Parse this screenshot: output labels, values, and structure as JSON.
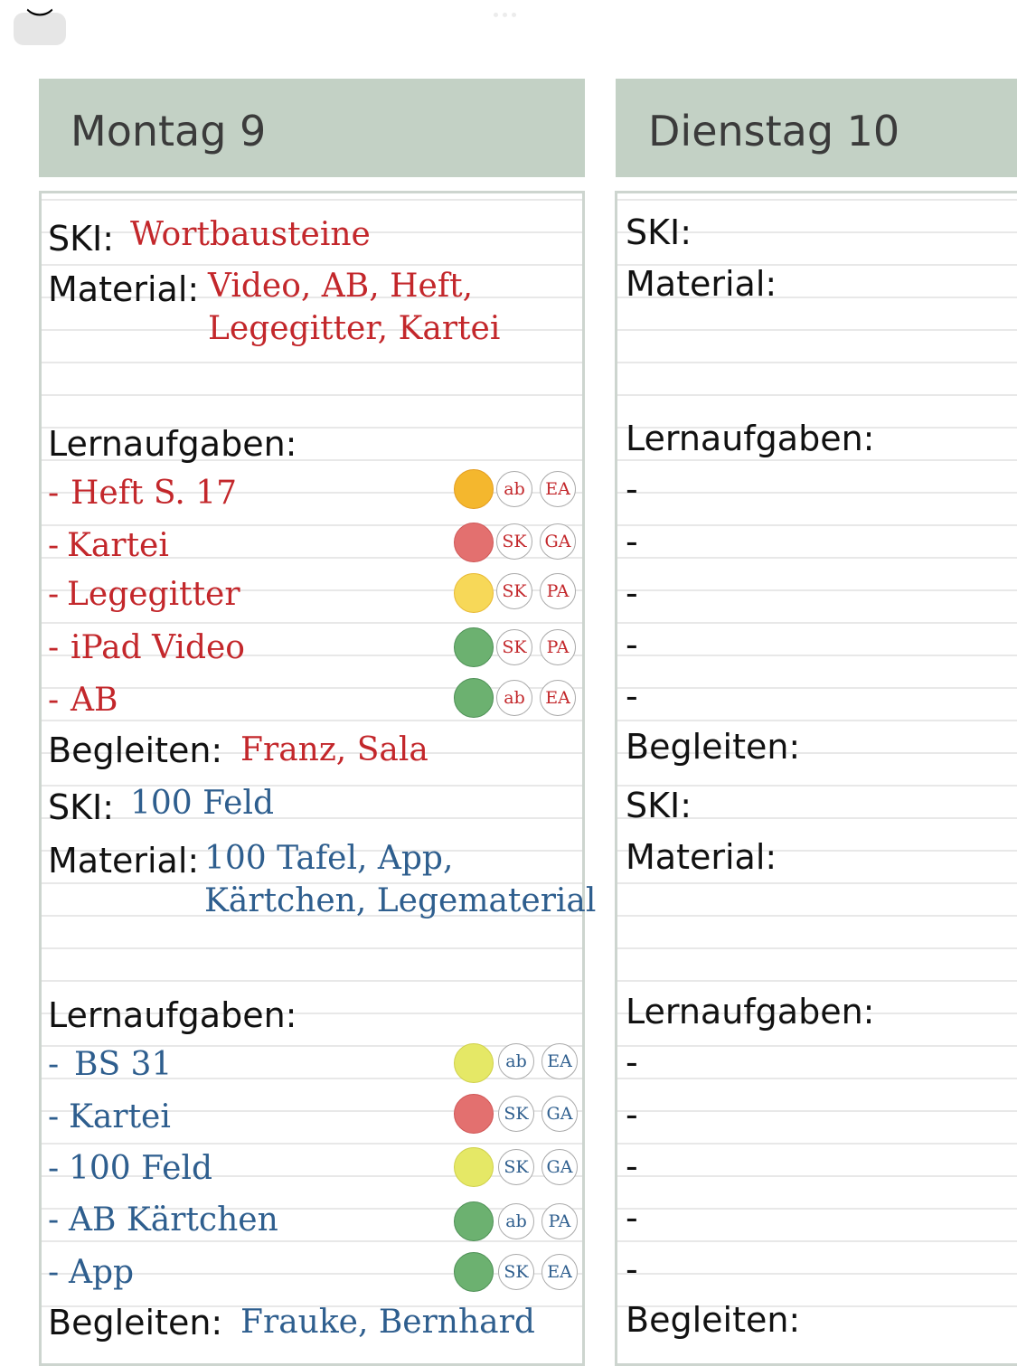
{
  "ui": {
    "collapse_icon": "︶"
  },
  "mon": {
    "title": "Montag 9",
    "s1": {
      "ski_label": "SKI:",
      "ski": "Wortbausteine",
      "mat_label": "Material:",
      "mat1": "Video, AB, Heft,",
      "mat2": "Legegitter, Kartei",
      "tasks_label": "Lernaufgaben:",
      "tasks": [
        {
          "text": "Heft S. 17",
          "dot": "orange",
          "b1": "ab",
          "b2": "EA"
        },
        {
          "text": "Kartei",
          "dot": "rose",
          "b1": "SK",
          "b2": "GA"
        },
        {
          "text": "Legegitter",
          "dot": "yellow",
          "b1": "SK",
          "b2": "PA"
        },
        {
          "text": "iPad Video",
          "dot": "green",
          "b1": "SK",
          "b2": "PA"
        },
        {
          "text": "AB",
          "dot": "green",
          "b1": "ab",
          "b2": "EA"
        }
      ],
      "beg_label": "Begleiten:",
      "beg": "Franz, Sala"
    },
    "s2": {
      "ski_label": "SKI:",
      "ski": "100 Feld",
      "mat_label": "Material:",
      "mat1": "100 Tafel, App,",
      "mat2": "Kärtchen, Legematerial",
      "tasks_label": "Lernaufgaben:",
      "tasks": [
        {
          "text": "BS 31",
          "dot": "lime",
          "b1": "ab",
          "b2": "EA"
        },
        {
          "text": "Kartei",
          "dot": "rose",
          "b1": "SK",
          "b2": "GA"
        },
        {
          "text": "100 Feld",
          "dot": "lime",
          "b1": "SK",
          "b2": "GA"
        },
        {
          "text": "AB Kärtchen",
          "dot": "green",
          "b1": "ab",
          "b2": "PA"
        },
        {
          "text": "App",
          "dot": "green",
          "b1": "SK",
          "b2": "EA"
        }
      ],
      "beg_label": "Begleiten:",
      "beg": "Frauke, Bernhard"
    }
  },
  "tue": {
    "title": "Dienstag 10",
    "ski_label": "SKI:",
    "mat_label": "Material:",
    "tasks_label": "Lernaufgaben:",
    "beg_label": "Begleiten:",
    "dash": "-"
  },
  "colors": {
    "header_bg": "#c3d1c5",
    "red_text": "#c3272b",
    "blue_text": "#2e5e8e"
  }
}
